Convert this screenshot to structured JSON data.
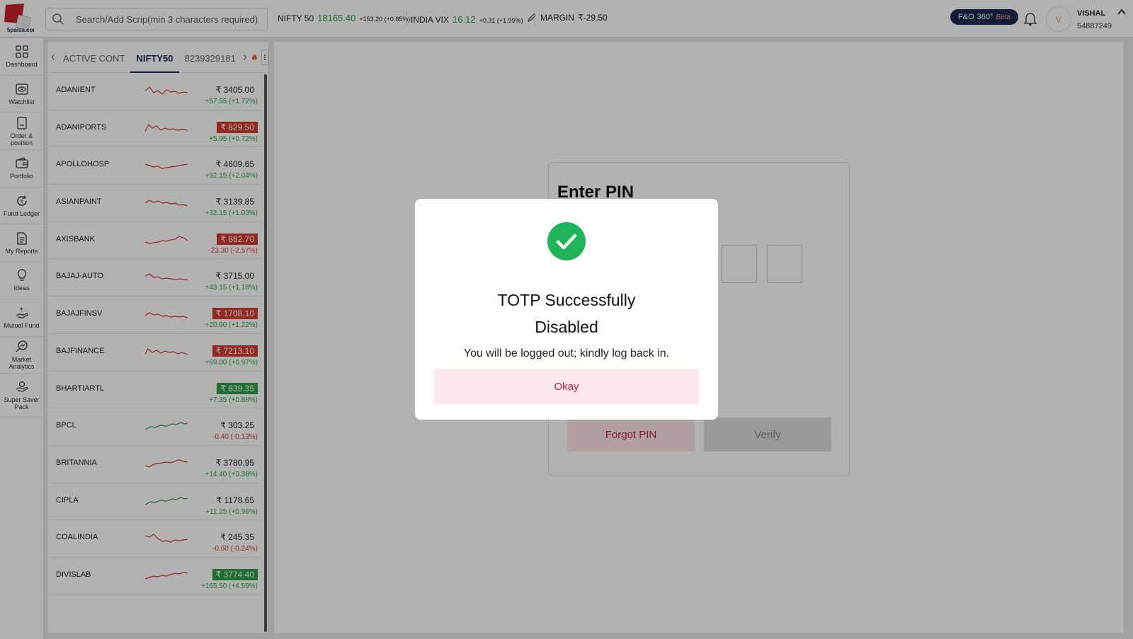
{
  "header": {
    "logo_text": "5paisa.com",
    "search_placeholder": "Search/Add Scrip(min 3 characters required)",
    "nifty": {
      "label": "NIFTY 50",
      "value": "18165.40",
      "change": "+153.20 (+0.85%)"
    },
    "vix": {
      "label": "INDIA VIX",
      "value": "16.12",
      "change": "+0.31 (+1.99%)"
    },
    "margin": {
      "label": "MARGIN",
      "value": "₹-29.50"
    },
    "fno_badge": {
      "label": "F&O",
      "suffix": "360°",
      "beta": "Beta"
    },
    "user": {
      "initial": "V",
      "name": "VISHAL",
      "id": "54887249"
    }
  },
  "sidebar": {
    "items": [
      {
        "label": "Dashboard",
        "icon": "grid-icon"
      },
      {
        "label": "Watchlist",
        "icon": "eye-icon"
      },
      {
        "label": "Order & position",
        "icon": "book-icon"
      },
      {
        "label": "Portfolio",
        "icon": "wallet-icon"
      },
      {
        "label": "Fund Ledger",
        "icon": "rupee-refresh-icon"
      },
      {
        "label": "My Reports",
        "icon": "report-icon"
      },
      {
        "label": "Ideas",
        "icon": "bulb-icon"
      },
      {
        "label": "Mutual Fund",
        "icon": "hand-rupee-icon"
      },
      {
        "label": "Market Analytics",
        "icon": "analytics-icon"
      },
      {
        "label": "Super Saver Pack",
        "icon": "saver-icon"
      }
    ]
  },
  "watchlist": {
    "tabs": [
      {
        "label": "ACTIVE CONT",
        "active": false
      },
      {
        "label": "NIFTY50",
        "active": true
      },
      {
        "label": "8239329181",
        "active": false
      }
    ],
    "rows": [
      {
        "symbol": "ADANIENT",
        "price": "₹ 3405.00",
        "change": "+57.55 (+1.72%)",
        "highlight": "none",
        "negative": false,
        "trend": "red"
      },
      {
        "symbol": "ADANIPORTS",
        "price": "₹ 829.50",
        "change": "+5.95 (+0.72%)",
        "highlight": "red",
        "negative": false,
        "trend": "red"
      },
      {
        "symbol": "APOLLOHOSP",
        "price": "₹ 4609.65",
        "change": "+92.15 (+2.04%)",
        "highlight": "none",
        "negative": false,
        "trend": "red"
      },
      {
        "symbol": "ASIANPAINT",
        "price": "₹ 3139.85",
        "change": "+32.15 (+1.03%)",
        "highlight": "none",
        "negative": false,
        "trend": "red"
      },
      {
        "symbol": "AXISBANK",
        "price": "₹ 882.70",
        "change": "-23.30 (-2.57%)",
        "highlight": "red",
        "negative": true,
        "trend": "red"
      },
      {
        "symbol": "BAJAJ-AUTO",
        "price": "₹ 3715.00",
        "change": "+43.15 (+1.18%)",
        "highlight": "none",
        "negative": false,
        "trend": "red"
      },
      {
        "symbol": "BAJAJFINSV",
        "price": "₹ 1708.10",
        "change": "+20.60 (+1.22%)",
        "highlight": "red",
        "negative": false,
        "trend": "red"
      },
      {
        "symbol": "BAJFINANCE",
        "price": "₹ 7213.10",
        "change": "+69.00 (+0.97%)",
        "highlight": "red",
        "negative": false,
        "trend": "red"
      },
      {
        "symbol": "BHARTIARTL",
        "price": "₹ 839.35",
        "change": "+7.35 (+0.88%)",
        "highlight": "green",
        "negative": false,
        "trend": "none"
      },
      {
        "symbol": "BPCL",
        "price": "₹ 303.25",
        "change": "-0.40 (-0.13%)",
        "highlight": "none",
        "negative": true,
        "trend": "green"
      },
      {
        "symbol": "BRITANNIA",
        "price": "₹ 3780.95",
        "change": "+14.40 (+0.38%)",
        "highlight": "none",
        "negative": false,
        "trend": "red"
      },
      {
        "symbol": "CIPLA",
        "price": "₹ 1178.65",
        "change": "+11.25 (+0.96%)",
        "highlight": "none",
        "negative": false,
        "trend": "green"
      },
      {
        "symbol": "COALINDIA",
        "price": "₹ 245.35",
        "change": "-0.60 (-0.24%)",
        "highlight": "none",
        "negative": true,
        "trend": "red"
      },
      {
        "symbol": "DIVISLAB",
        "price": "₹ 3774.40",
        "change": "+165.50 (+4.59%)",
        "highlight": "green",
        "negative": false,
        "trend": "red"
      }
    ]
  },
  "pin_panel": {
    "title": "Enter PIN",
    "forgot_label": "Forgot PIN",
    "verify_label": "Verify"
  },
  "dialog": {
    "title": "TOTP  Successfully Disabled",
    "message": "You will be logged out; kindly log back in.",
    "okay_label": "Okay"
  },
  "colors": {
    "positive": "#2e9e48",
    "negative": "#d43b32",
    "accent": "#c61a44",
    "navy": "#1a2a55"
  }
}
